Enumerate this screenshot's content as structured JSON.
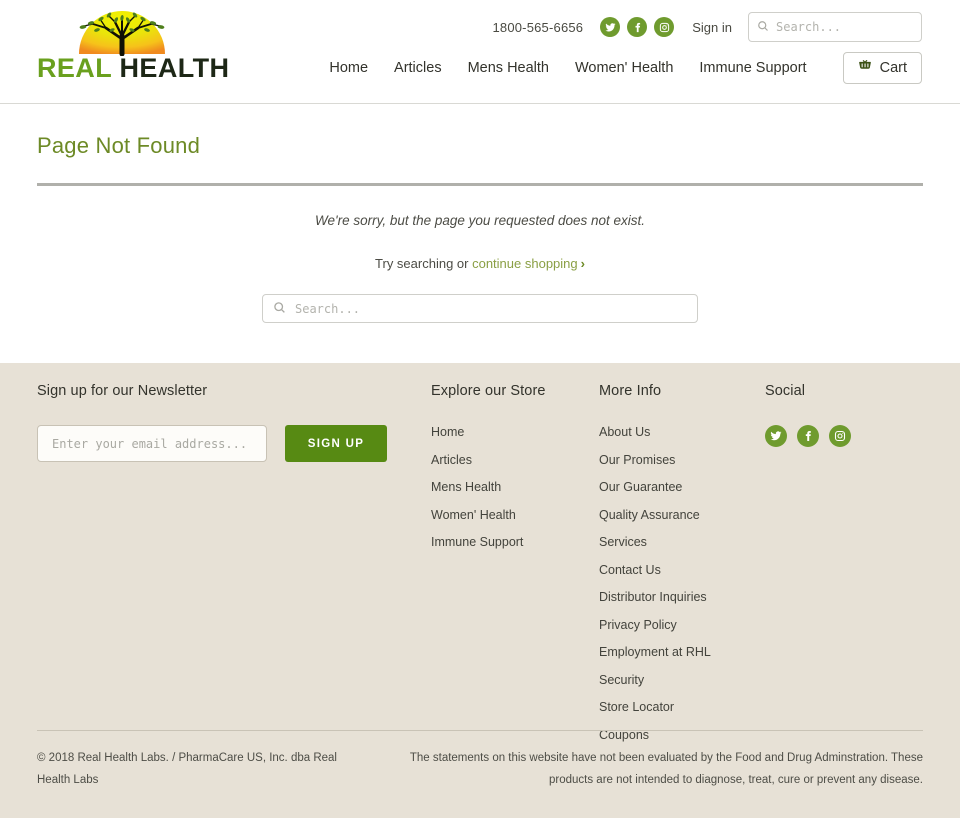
{
  "header": {
    "logo": {
      "text_part1": "REAL",
      "text_part2": " HEALTH",
      "alt": "Real Health logo"
    },
    "phone": "1800-565-6656",
    "signin_label": "Sign in",
    "search_placeholder": "Search...",
    "search_value": "",
    "social": [
      {
        "name": "twitter",
        "label": "Twitter"
      },
      {
        "name": "facebook",
        "label": "Facebook"
      },
      {
        "name": "instagram",
        "label": "Instagram"
      }
    ],
    "nav": [
      {
        "label": "Home"
      },
      {
        "label": "Articles"
      },
      {
        "label": "Mens Health"
      },
      {
        "label": "Women' Health"
      },
      {
        "label": "Immune Support"
      }
    ],
    "cart_label": "Cart"
  },
  "main": {
    "title": "Page Not Found",
    "message": "We're sorry, but the page you requested does not exist.",
    "try_prefix": "Try searching or ",
    "continue_link": "continue shopping",
    "chevron": "›",
    "search_placeholder": "Search...",
    "search_value": ""
  },
  "footer": {
    "newsletter": {
      "title": "Sign up for our Newsletter",
      "email_placeholder": "Enter your email address...",
      "email_value": "",
      "button_label": "SIGN UP"
    },
    "store": {
      "title": "Explore our Store",
      "links": [
        {
          "label": "Home"
        },
        {
          "label": "Articles"
        },
        {
          "label": "Mens Health"
        },
        {
          "label": "Women' Health"
        },
        {
          "label": "Immune Support"
        }
      ]
    },
    "more": {
      "title": "More Info",
      "links": [
        {
          "label": "About Us"
        },
        {
          "label": "Our Promises"
        },
        {
          "label": "Our Guarantee"
        },
        {
          "label": "Quality Assurance"
        },
        {
          "label": "Services"
        },
        {
          "label": "Contact Us"
        },
        {
          "label": "Distributor Inquiries"
        },
        {
          "label": "Privacy Policy"
        },
        {
          "label": "Employment at RHL"
        },
        {
          "label": "Security"
        },
        {
          "label": "Store Locator"
        },
        {
          "label": "Coupons"
        }
      ]
    },
    "social": {
      "title": "Social",
      "items": [
        {
          "name": "twitter",
          "label": "Twitter"
        },
        {
          "name": "facebook",
          "label": "Facebook"
        },
        {
          "name": "instagram",
          "label": "Instagram"
        }
      ]
    },
    "bottom": {
      "copyright_link": "© 2018 Real Health Labs.",
      "copyright_rest": " / PharmaCare US, Inc. dba Real Health Labs",
      "disclaimer": "The statements on this website have not been evaluated by the Food and Drug Adminstration. These products are not intended to diagnose, treat, cure or prevent any disease."
    }
  },
  "colors": {
    "brand_green": "#6aa01e",
    "title_green": "#6d8a26",
    "social_green": "#6f9b2e",
    "button_green": "#578a13",
    "footer_bg": "#e7e1d6",
    "link_olive": "#8a9f44"
  }
}
